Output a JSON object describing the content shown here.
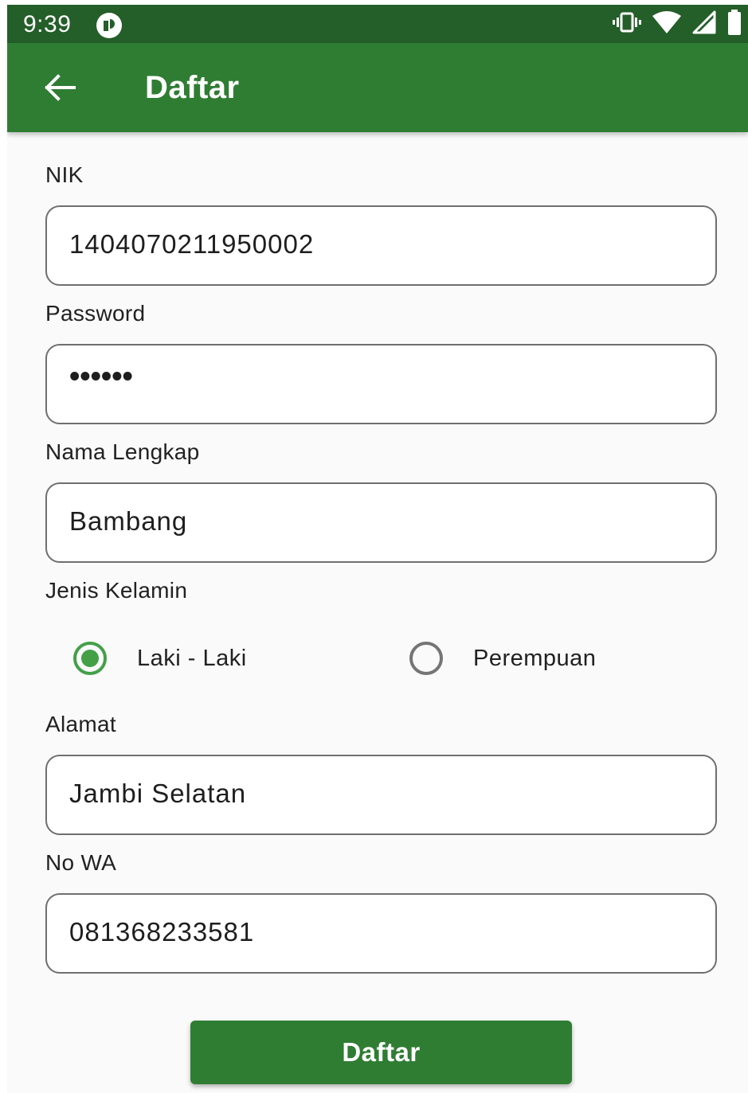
{
  "status_bar": {
    "time": "9:39",
    "app_icon": "notification-app-icon",
    "icons": [
      "vibrate-icon",
      "wifi-icon",
      "cell-signal-icon",
      "battery-icon"
    ]
  },
  "app_bar": {
    "back_icon": "arrow-back-icon",
    "title": "Daftar"
  },
  "form": {
    "nik": {
      "label": "NIK",
      "value": "1404070211950002"
    },
    "password": {
      "label": "Password",
      "value": "••••••"
    },
    "nama": {
      "label": "Nama Lengkap",
      "value": "Bambang"
    },
    "gender": {
      "label": "Jenis Kelamin",
      "options": [
        {
          "label": "Laki - Laki",
          "selected": true
        },
        {
          "label": "Perempuan",
          "selected": false
        }
      ]
    },
    "alamat": {
      "label": "Alamat",
      "value": "Jambi Selatan"
    },
    "no_wa": {
      "label": "No WA",
      "value": "081368233581"
    },
    "submit_label": "Daftar"
  },
  "colors": {
    "primary": "#2f7d33",
    "primary_dark": "#245e29",
    "accent": "#43a047",
    "background": "#fafafa"
  }
}
